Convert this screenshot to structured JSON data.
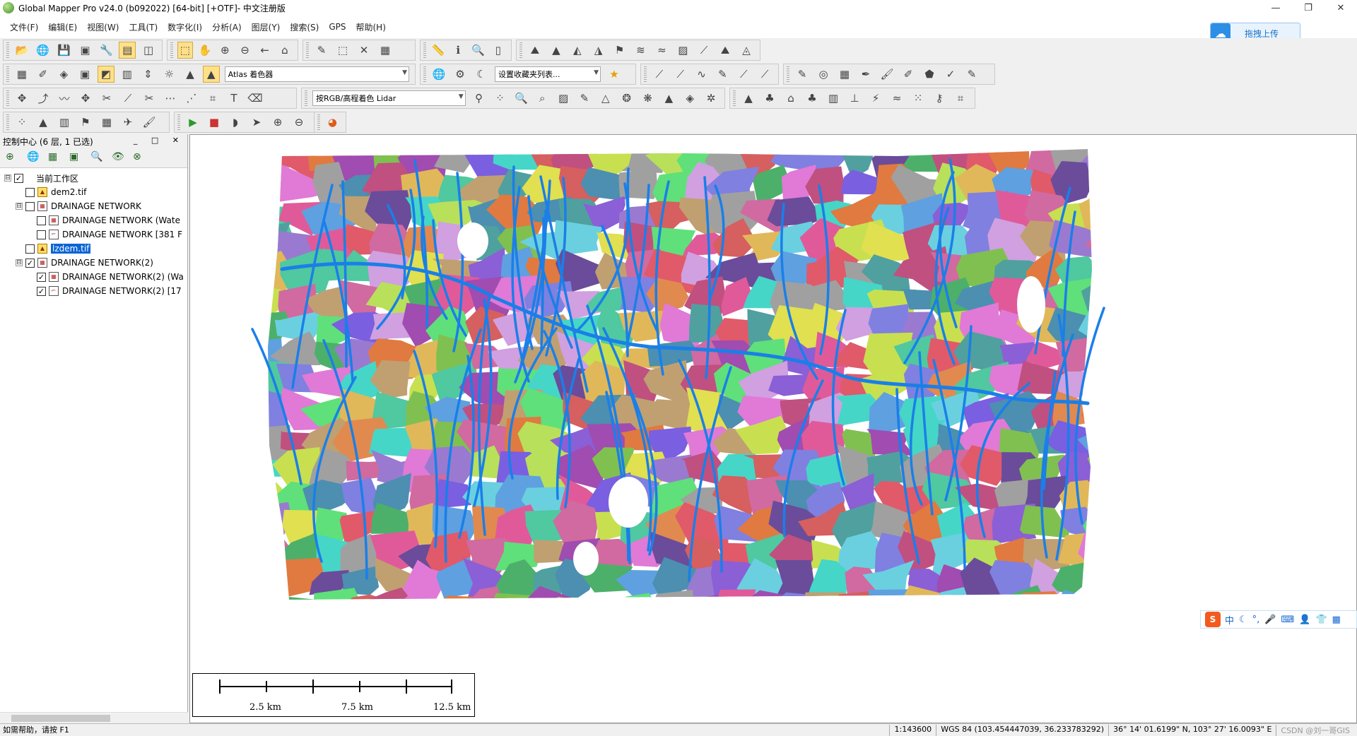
{
  "window": {
    "title": "Global Mapper Pro v24.0 (b092022) [64-bit] [+OTF]- 中文注册版",
    "minimize": "—",
    "maximize": "❐",
    "close": "✕"
  },
  "menu": [
    "文件(F)",
    "编辑(E)",
    "视图(W)",
    "工具(T)",
    "数字化(I)",
    "分析(A)",
    "图层(Y)",
    "搜索(S)",
    "GPS",
    "帮助(H)"
  ],
  "upload": {
    "label": "拖拽上传"
  },
  "toolbar": {
    "shader_select": "Atlas 着色器",
    "favorites_select": "设置收藏夹列表...",
    "lidar_select": "按RGB/高程着色 Lidar"
  },
  "panel": {
    "title": "控制中心 (6 层, 1 已选)",
    "buttons": "_ □ ✕",
    "tree": [
      {
        "label": "当前工作区",
        "level": 0,
        "checked": true,
        "icon": "",
        "expand": "⊟"
      },
      {
        "label": "dem2.tif",
        "level": 1,
        "checked": false,
        "icon": "raster",
        "expand": ""
      },
      {
        "label": "DRAINAGE NETWORK",
        "level": 1,
        "checked": false,
        "icon": "group",
        "expand": "⊟"
      },
      {
        "label": "DRAINAGE NETWORK (Wate",
        "level": 2,
        "checked": false,
        "icon": "area",
        "expand": ""
      },
      {
        "label": "DRAINAGE NETWORK [381 F",
        "level": 2,
        "checked": false,
        "icon": "line",
        "expand": ""
      },
      {
        "label": "lzdem.tif",
        "level": 1,
        "checked": false,
        "icon": "raster",
        "expand": "",
        "selected": true
      },
      {
        "label": "DRAINAGE NETWORK(2)",
        "level": 1,
        "checked": true,
        "icon": "group",
        "expand": "⊟"
      },
      {
        "label": "DRAINAGE NETWORK(2) (Wa",
        "level": 2,
        "checked": true,
        "icon": "area",
        "expand": ""
      },
      {
        "label": "DRAINAGE NETWORK(2) [17",
        "level": 2,
        "checked": true,
        "icon": "line",
        "expand": ""
      }
    ]
  },
  "scalebar": {
    "labels": [
      "2.5 km",
      "7.5 km",
      "12.5 km"
    ]
  },
  "ime": {
    "label": "中"
  },
  "status": {
    "help": "如需帮助，请按 F1",
    "scale": "1:143600",
    "coords": "WGS 84 (103.454447039, 36.233783292)",
    "dms": "36° 14' 01.6199\" N, 103° 27' 16.0093\" E",
    "watermark": "CSDN @刘一哥GIS"
  },
  "colors": {
    "stream": "#1a7fe8",
    "selection": "#0a64d6",
    "brand": "#2d8ee6"
  }
}
